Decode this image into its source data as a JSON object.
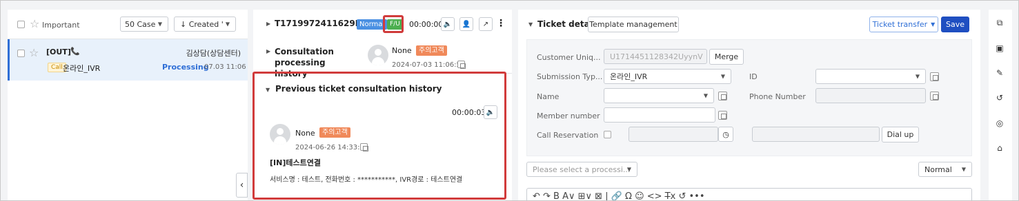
{
  "left": {
    "important_label": "Important",
    "cases_select": "50 Case",
    "sort_select": "↓ Created '",
    "item": {
      "title": "[OUT]",
      "agent": "김상담(상담센터)",
      "channel_tag": "Call",
      "channel_name": "온라인_IVR",
      "status": "Processing",
      "time": "07.03 11:06"
    },
    "collapse_arrow": "‹"
  },
  "middle": {
    "ticket_id": "T1719972411629I3qrx",
    "priority_tag": "Normal",
    "fu_tag": "F/U",
    "timer": "00:00:00",
    "consultation_label": "Consultation processing history",
    "consultation_name": "None",
    "consultation_badge": "주의고객",
    "consultation_time": "2024-07-03 11:06:52",
    "previous_title": "Previous ticket consultation history",
    "previous_timer": "00:00:03",
    "previous_name": "None",
    "previous_badge": "주의고객",
    "previous_time": "2024-06-26 14:33:46",
    "previous_subject": "[IN]테스트연결",
    "previous_body": "서비스명 : 테스트, 전화번호 : ***********, IVR경로 : 테스트연결"
  },
  "right": {
    "title": "Ticket details",
    "template_btn": "Template management",
    "transfer_btn": "Ticket transfer",
    "save_btn": "Save",
    "customer_label": "Customer Uniq...",
    "customer_value": "U1714451128342UyynV",
    "merge_btn": "Merge",
    "submission_label": "Submission Typ...",
    "submission_value": "온라인_IVR",
    "id_label": "ID",
    "name_label": "Name",
    "phone_label": "Phone Number",
    "member_label": "Member number",
    "call_res_label": "Call Reservation",
    "dial_btn": "Dial up",
    "process_placeholder": "Please select a processi...",
    "priority_select": "Normal",
    "toolbar": "↶ ↷  B  A∨  ⊞∨  ⊠  |  🔗  Ω  ☺  <>  T̶x  ↺   •••"
  },
  "colors": {
    "accent": "#2f6fd6",
    "save": "#1f4fc1",
    "normal_tag": "#4a90e2",
    "fu_tag": "#4caf50",
    "warn_badge": "#f0895a",
    "highlight": "#d13b3b",
    "processing": "#2f6fd6"
  }
}
